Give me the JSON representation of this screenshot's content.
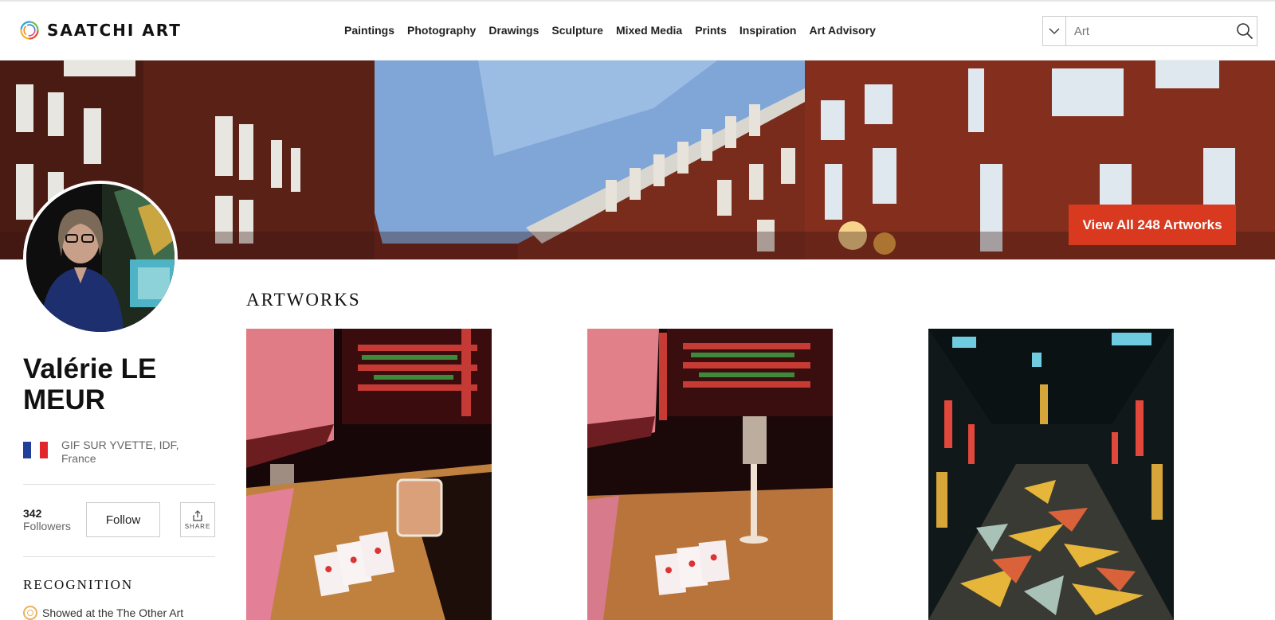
{
  "header": {
    "logo_text": "SAATCHI ART",
    "nav": [
      "Paintings",
      "Photography",
      "Drawings",
      "Sculpture",
      "Mixed Media",
      "Prints",
      "Inspiration",
      "Art Advisory"
    ],
    "search_placeholder": "Art"
  },
  "banner": {
    "view_all_label": "View All 248 Artworks"
  },
  "artist": {
    "name": "Valérie LE MEUR",
    "location": "GIF SUR YVETTE, IDF, France",
    "followers_count": "342",
    "followers_label": "Followers",
    "follow_label": "Follow",
    "share_label": "SHARE"
  },
  "sections": {
    "artworks_title": "ARTWORKS",
    "recognition_title": "RECOGNITION",
    "recognition_item": "Showed at the The Other Art"
  },
  "colors": {
    "accent": "#d8391f",
    "flag_blue": "#1f3f99",
    "flag_white": "#ffffff",
    "flag_red": "#e1252b"
  },
  "icons": {
    "logo": "saatchi-rings-icon",
    "dropdown": "chevron-down-icon",
    "search": "search-icon",
    "share": "share-icon",
    "recognition": "award-ring-icon"
  }
}
